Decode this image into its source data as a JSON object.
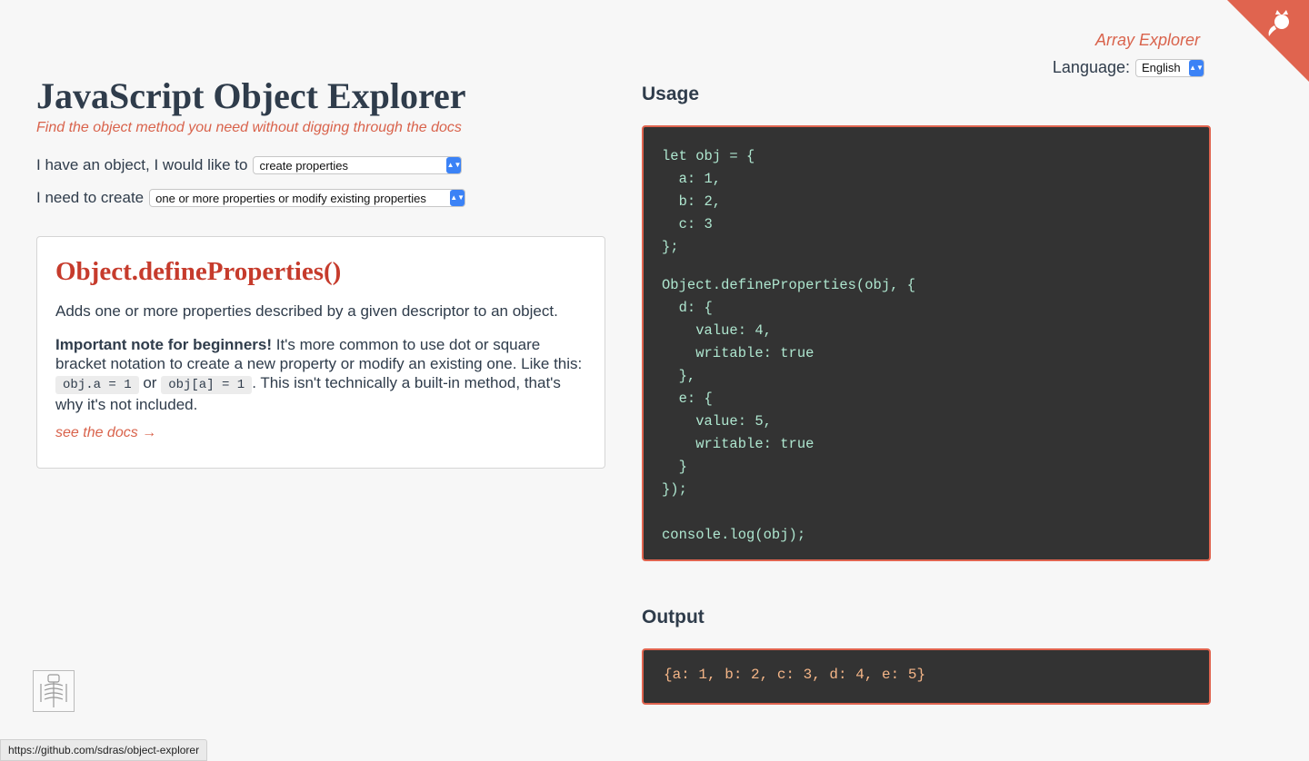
{
  "header": {
    "alt_link": "Array Explorer",
    "language_label": "Language:",
    "language_value": "English"
  },
  "main": {
    "title": "JavaScript Object Explorer",
    "tagline": "Find the object method you need without digging through the docs",
    "question1_label": "I have an object, I would like to",
    "question1_value": "create properties",
    "question2_label": "I need to create",
    "question2_value": "one or more properties or modify existing properties"
  },
  "card": {
    "method": "Object.defineProperties()",
    "description": "Adds one or more properties described by a given descriptor to an object.",
    "note_bold": "Important note for beginners!",
    "note_text1": " It's more common to use dot or square bracket notation to create a new property or modify an existing one. Like this: ",
    "note_code1": "obj.a = 1",
    "note_or": " or ",
    "note_code2": "obj[a] = 1",
    "note_text2": ". This isn't technically a built-in method, that's why it's not included.",
    "docs_link": "see the docs →"
  },
  "usage": {
    "heading": "Usage",
    "block1": "let obj = {\n  a: 1,\n  b: 2,\n  c: 3\n};",
    "block2": "Object.defineProperties(obj, {\n  d: {\n    value: 4,\n    writable: true\n  },\n  e: {\n    value: 5,\n    writable: true\n  }\n});\n\nconsole.log(obj);"
  },
  "output": {
    "heading": "Output",
    "value": "{a: 1, b: 2, c: 3, d: 4, e: 5}"
  },
  "status_bar": "https://github.com/sdras/object-explorer",
  "colors": {
    "accent": "#d9634c",
    "heading": "#2f3c4b",
    "code_bg": "#333333",
    "method": "#c63b2c"
  }
}
